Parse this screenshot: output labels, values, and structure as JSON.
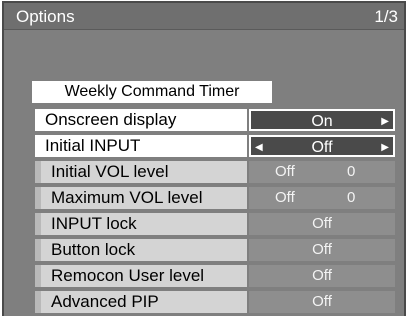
{
  "menu": {
    "title": "Options",
    "page": "1/3"
  },
  "weekly_timer": "Weekly Command Timer",
  "rows": [
    {
      "label": "Onscreen display",
      "value": "On"
    },
    {
      "label": "Initial INPUT",
      "value": "Off"
    },
    {
      "label": "Initial VOL level",
      "value": "Off",
      "number": "0"
    },
    {
      "label": "Maximum VOL level",
      "value": "Off",
      "number": "0"
    },
    {
      "label": "INPUT lock",
      "value": "Off"
    },
    {
      "label": "Button lock",
      "value": "Off"
    },
    {
      "label": "Remocon User level",
      "value": "Off"
    },
    {
      "label": "Advanced PIP",
      "value": "Off"
    }
  ],
  "icons": {
    "left": "arrow-left-icon",
    "right": "arrow-right-icon"
  },
  "colors": {
    "panel": "#7f7f7f",
    "highlight": "#ffffff",
    "inactive": "#d4d4d4"
  }
}
